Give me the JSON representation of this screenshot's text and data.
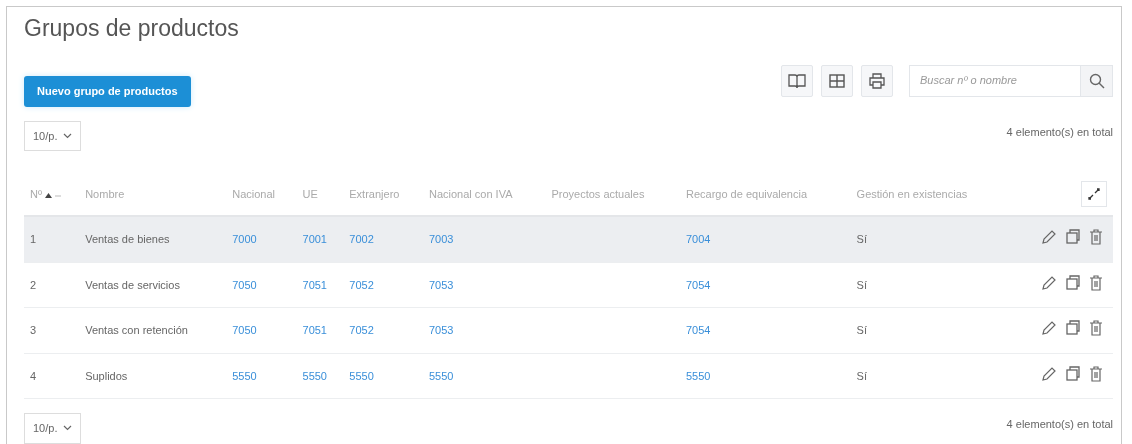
{
  "title": "Grupos de productos",
  "new_button": "Nuevo grupo de productos",
  "search": {
    "placeholder": "Buscar nº o nombre"
  },
  "page_size_top": "10/p.",
  "total_top": "4 elemento(s) en total",
  "table": {
    "columns": [
      {
        "label": "Nº",
        "sorted": true
      },
      {
        "label": "Nombre",
        "sorted": false
      },
      {
        "label": "Nacional",
        "sorted": false
      },
      {
        "label": "UE",
        "sorted": false
      },
      {
        "label": "Extranjero",
        "sorted": false
      },
      {
        "label": "Nacional con IVA",
        "sorted": false
      },
      {
        "label": "Proyectos actuales",
        "sorted": false
      },
      {
        "label": "Recargo de equivalencia",
        "sorted": false
      },
      {
        "label": "Gestión en existencias",
        "sorted": false
      }
    ],
    "rows": [
      {
        "number": "1",
        "name": "Ventas de bienes",
        "nacional": "7000",
        "ue": "7001",
        "extranjero": "7002",
        "nacional_iva": "7003",
        "recargo": "7004",
        "existencias": "Sí",
        "selected": true
      },
      {
        "number": "2",
        "name": "Ventas de servicios",
        "nacional": "7050",
        "ue": "7051",
        "extranjero": "7052",
        "nacional_iva": "7053",
        "recargo": "7054",
        "existencias": "Sí",
        "selected": false
      },
      {
        "number": "3",
        "name": "Ventas con retención",
        "nacional": "7050",
        "ue": "7051",
        "extranjero": "7052",
        "nacional_iva": "7053",
        "recargo": "7054",
        "existencias": "Sí",
        "selected": false
      },
      {
        "number": "4",
        "name": "Suplidos",
        "nacional": "5550",
        "ue": "5550",
        "extranjero": "5550",
        "nacional_iva": "5550",
        "recargo": "5550",
        "existencias": "Sí",
        "selected": false
      }
    ]
  },
  "page_size_bottom": "10/p.",
  "total_bottom": "4 elemento(s) en total"
}
